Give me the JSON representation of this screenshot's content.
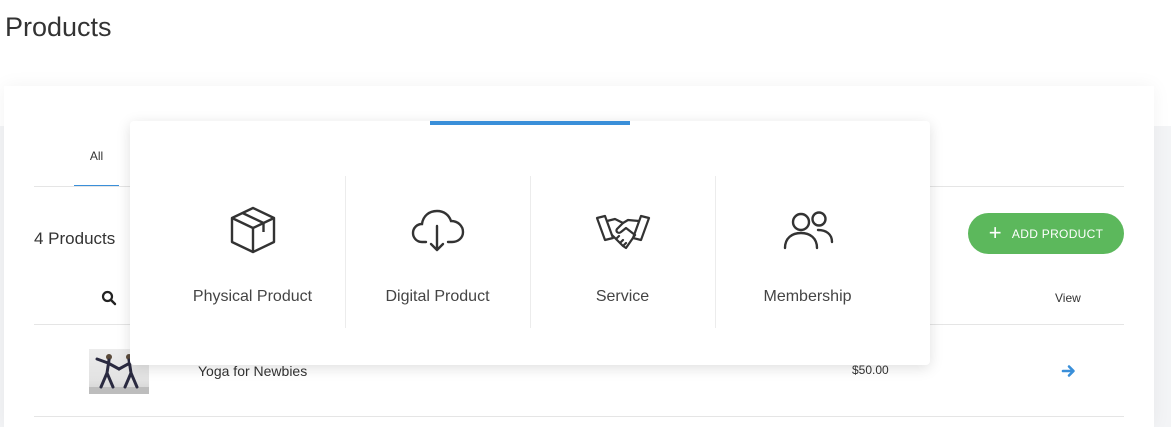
{
  "page": {
    "title": "Products"
  },
  "tabs": [
    {
      "label": "All",
      "active": true
    }
  ],
  "toolbar": {
    "count_label": "4 Products",
    "add_button_label": "ADD PRODUCT",
    "add_button_color": "#5cb85c"
  },
  "table": {
    "columns": {
      "view": "View"
    },
    "rows": [
      {
        "name": "Yoga for Newbies",
        "price": "$50.00"
      }
    ]
  },
  "product_type_menu": {
    "accent_color": "#3a8fd9",
    "options": [
      {
        "label": "Physical Product",
        "icon": "box-icon"
      },
      {
        "label": "Digital Product",
        "icon": "cloud-download-icon"
      },
      {
        "label": "Service",
        "icon": "handshake-icon"
      },
      {
        "label": "Membership",
        "icon": "users-icon"
      }
    ]
  }
}
